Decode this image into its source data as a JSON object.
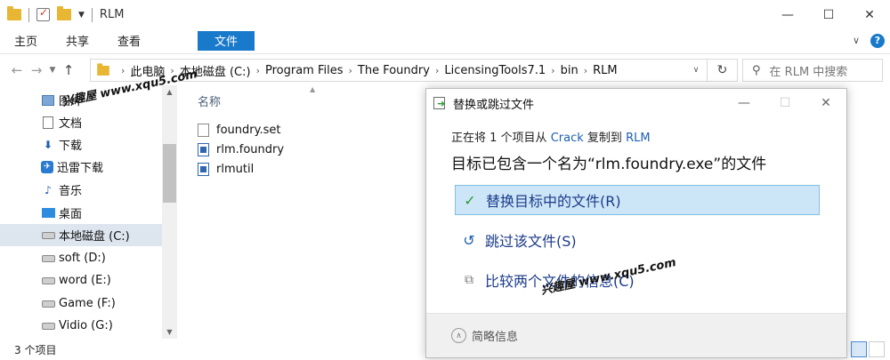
{
  "window": {
    "title": "RLM"
  },
  "ribbon": {
    "tabs": [
      "文件",
      "主页",
      "共享",
      "查看"
    ]
  },
  "address": {
    "crumbs": [
      "此电脑",
      "本地磁盘 (C:)",
      "Program Files",
      "The Foundry",
      "LicensingTools7.1",
      "bin",
      "RLM"
    ],
    "search_placeholder": "在 RLM 中搜索"
  },
  "sidebar": {
    "items": [
      {
        "label": "图片",
        "icon": "pictures-icon"
      },
      {
        "label": "文档",
        "icon": "document-icon"
      },
      {
        "label": "下载",
        "icon": "download-icon"
      },
      {
        "label": "迅雷下载",
        "icon": "thunder-icon"
      },
      {
        "label": "音乐",
        "icon": "music-icon"
      },
      {
        "label": "桌面",
        "icon": "desktop-icon"
      },
      {
        "label": "本地磁盘 (C:)",
        "icon": "drive-icon",
        "selected": true
      },
      {
        "label": "soft (D:)",
        "icon": "drive-icon"
      },
      {
        "label": "word (E:)",
        "icon": "drive-icon"
      },
      {
        "label": "Game (F:)",
        "icon": "drive-icon"
      },
      {
        "label": "Vidio (G:)",
        "icon": "drive-icon"
      }
    ]
  },
  "filelist": {
    "column_name": "名称",
    "files": [
      {
        "name": "foundry.set",
        "icon": "file-icon"
      },
      {
        "name": "rlm.foundry",
        "icon": "app-file-icon"
      },
      {
        "name": "rlmutil",
        "icon": "app-file-icon"
      }
    ]
  },
  "status": {
    "count": "3 个项目"
  },
  "watermarks": {
    "top": "兴趣屋 www.xqu5.com",
    "dialog": "兴趣屋 www.xqu5.com"
  },
  "dialog": {
    "title": "替换或跳过文件",
    "line1_prefix": "正在将 1 个项目从",
    "line1_source": "Crack",
    "line1_mid": "复制到",
    "line1_dest": "RLM",
    "line2": "目标已包含一个名为“rlm.foundry.exe”的文件",
    "options": [
      "替换目标中的文件(R)",
      "跳过该文件(S)",
      "比较两个文件的信息(C)"
    ],
    "footer": "简略信息"
  }
}
